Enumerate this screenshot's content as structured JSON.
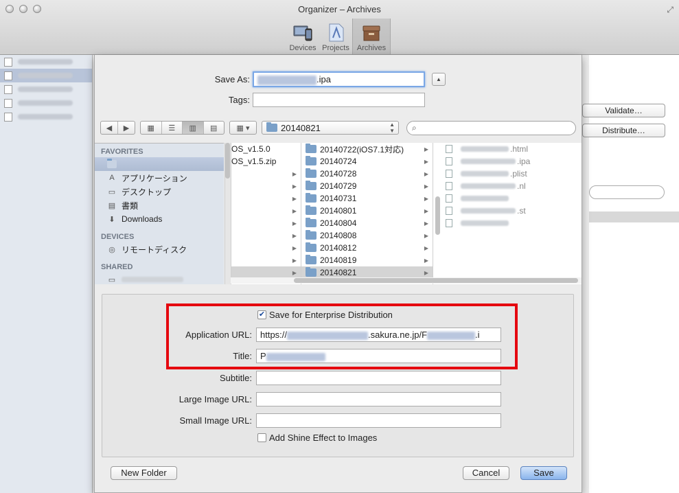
{
  "window": {
    "title": "Organizer – Archives"
  },
  "toolbar": {
    "items": [
      {
        "label": "Devices",
        "icon": "devices-icon"
      },
      {
        "label": "Projects",
        "icon": "projects-icon"
      },
      {
        "label": "Archives",
        "icon": "archives-icon"
      }
    ]
  },
  "organizer": {
    "validate_label": "Validate…",
    "distribute_label": "Distribute…"
  },
  "save_panel": {
    "save_as_label": "Save As:",
    "save_as_suffix": ".ipa",
    "tags_label": "Tags:",
    "tags_value": "",
    "path_popup": "20140821"
  },
  "sidebar": {
    "favorites_header": "FAVORITES",
    "favorites": [
      "アプリケーション",
      "デスクトップ",
      "書類",
      "Downloads"
    ],
    "devices_header": "DEVICES",
    "devices": [
      "リモートディスク"
    ],
    "shared_header": "SHARED"
  },
  "column1": {
    "items": [
      "OS_v1.5.0",
      "OS_v1.5.zip"
    ]
  },
  "column2": {
    "items": [
      "20140722(iOS7.1対応)",
      "20140724",
      "20140728",
      "20140729",
      "20140731",
      "20140801",
      "20140804",
      "20140808",
      "20140812",
      "20140819",
      "20140821"
    ],
    "selected": "20140821"
  },
  "column3": {
    "items": [
      ".html",
      ".ipa",
      ".plist",
      ".nl",
      "",
      ".st",
      ""
    ]
  },
  "options": {
    "enterprise_label": "Save for Enterprise Distribution",
    "enterprise_checked": true,
    "app_url_label": "Application URL:",
    "app_url_prefix": "https://",
    "app_url_middle": ".sakura.ne.jp/F",
    "app_url_suffix": ".i",
    "title_label": "Title:",
    "title_prefix": "P",
    "subtitle_label": "Subtitle:",
    "large_image_label": "Large Image URL:",
    "small_image_label": "Small Image URL:",
    "shine_label": "Add Shine Effect to Images",
    "shine_checked": false
  },
  "footer": {
    "new_folder_label": "New Folder",
    "cancel_label": "Cancel",
    "save_label": "Save"
  }
}
